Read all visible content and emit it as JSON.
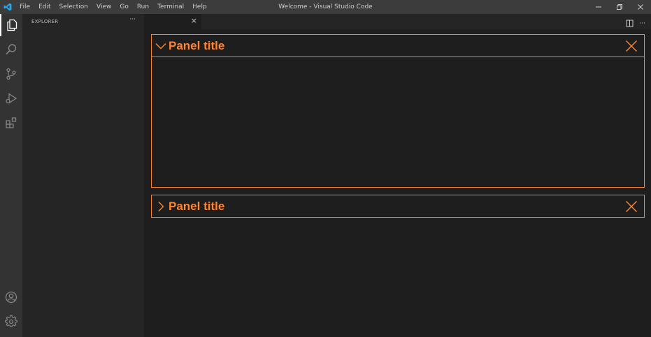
{
  "window": {
    "title": "Welcome - Visual Studio Code"
  },
  "menu": [
    "File",
    "Edit",
    "Selection",
    "View",
    "Go",
    "Run",
    "Terminal",
    "Help"
  ],
  "activity_icons": [
    "explorer-icon",
    "search-icon",
    "source-control-icon",
    "run-debug-icon",
    "extensions-icon",
    "account-icon",
    "settings-gear-icon"
  ],
  "sidebar": {
    "header": "EXPLORER",
    "more": "···"
  },
  "editor": {
    "tab_close": "×",
    "actions_more": "···"
  },
  "panels": [
    {
      "title": "Panel title",
      "expanded": true
    },
    {
      "title": "Panel title",
      "expanded": false
    }
  ],
  "colors": {
    "accent": "#ff8533",
    "titlebar": "#3c3c3c",
    "activitybar": "#333333",
    "sidebar": "#252526",
    "editor": "#1e1e1e"
  }
}
